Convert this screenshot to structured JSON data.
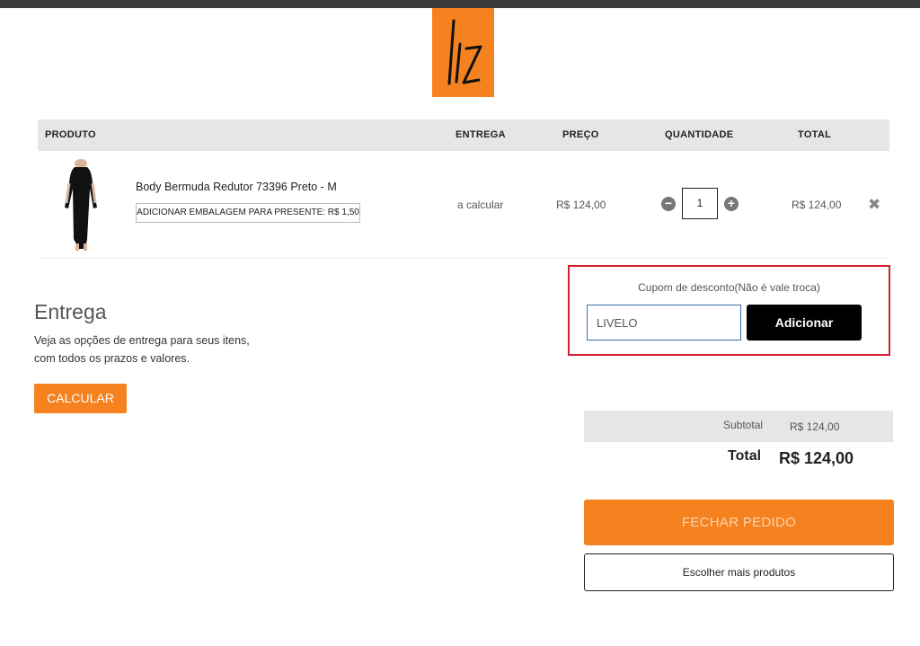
{
  "brand": {
    "accent_color": "#f5821f",
    "logo_icon": "liz-logo-icon"
  },
  "table": {
    "headers": {
      "product": "PRODUTO",
      "delivery": "ENTREGA",
      "price": "PREÇO",
      "quantity": "QUANTIDADE",
      "total": "TOTAL"
    },
    "rows": [
      {
        "name": "Body Bermuda Redutor 73396 Preto - M",
        "gift_wrap_label": "ADICIONAR EMBALAGEM PARA PRESENTE: R$ 1,50",
        "delivery": "a calcular",
        "price": "R$ 124,00",
        "quantity": "1",
        "total": "R$ 124,00"
      }
    ]
  },
  "coupon": {
    "label": "Cupom de desconto(Não é vale troca)",
    "value": "LIVELO",
    "button_label": "Adicionar"
  },
  "delivery": {
    "title": "Entrega",
    "description": "Veja as opções de entrega para seus itens, com todos os prazos e valores.",
    "button_label": "CALCULAR"
  },
  "summary": {
    "subtotal_label": "Subtotal",
    "subtotal_value": "R$ 124,00",
    "total_label": "Total",
    "total_value": "R$ 124,00"
  },
  "actions": {
    "checkout_label": "FECHAR PEDIDO",
    "continue_label": "Escolher mais produtos"
  }
}
